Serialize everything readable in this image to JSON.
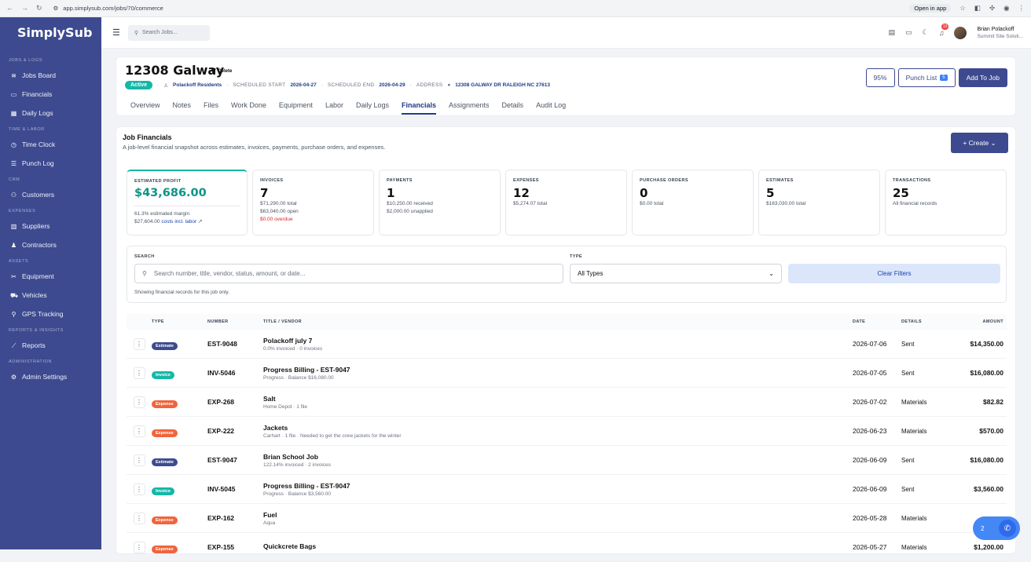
{
  "browser": {
    "url": "app.simplysub.com/jobs/70/commerce",
    "open_in_app": "Open in app"
  },
  "sidebar": {
    "logo": "SimplySub",
    "sections": [
      {
        "title": "JOBS & LOGS",
        "items": [
          {
            "label": "Jobs Board",
            "icon": "layers-icon"
          },
          {
            "label": "Financials",
            "icon": "cash-icon"
          },
          {
            "label": "Daily Logs",
            "icon": "calendar-icon"
          }
        ]
      },
      {
        "title": "TIME & LABOR",
        "items": [
          {
            "label": "Time Clock",
            "icon": "clock-icon"
          },
          {
            "label": "Punch Log",
            "icon": "list-icon"
          }
        ]
      },
      {
        "title": "CRM",
        "items": [
          {
            "label": "Customers",
            "icon": "users-icon"
          }
        ]
      },
      {
        "title": "EXPENSES",
        "items": [
          {
            "label": "Suppliers",
            "icon": "building-icon"
          },
          {
            "label": "Contractors",
            "icon": "person-icon"
          }
        ]
      },
      {
        "title": "ASSETS",
        "items": [
          {
            "label": "Equipment",
            "icon": "tools-icon"
          },
          {
            "label": "Vehicles",
            "icon": "car-icon"
          },
          {
            "label": "GPS Tracking",
            "icon": "pin-icon"
          }
        ]
      },
      {
        "title": "REPORTS & INSIGHTS",
        "items": [
          {
            "label": "Reports",
            "icon": "chart-icon"
          }
        ]
      },
      {
        "title": "ADMINISTRATION",
        "items": [
          {
            "label": "Admin Settings",
            "icon": "gear-icon"
          }
        ]
      }
    ]
  },
  "topbar": {
    "search_placeholder": "Search Jobs...",
    "notif_count": "13",
    "user_name": "Brian Polackoff",
    "user_company": "Summit Site Soluti..."
  },
  "job": {
    "title": "12308 Galway",
    "delete_label": "Delete",
    "status": "Active",
    "customer": "Polackoff Residents",
    "start_label": "SCHEDULED START",
    "start": "2026-04-27",
    "end_label": "SCHEDULED END",
    "end": "2026-04-29",
    "address_label": "ADDRESS",
    "address": "12308 GALWAY DR RALEIGH NC 27613",
    "progress": "95%",
    "punch_label": "Punch List",
    "punch_count": "5",
    "add_label": "Add To Job",
    "tabs": [
      "Overview",
      "Notes",
      "Files",
      "Work Done",
      "Equipment",
      "Labor",
      "Daily Logs",
      "Financials",
      "Assignments",
      "Details",
      "Audit Log"
    ],
    "active_tab": "Financials"
  },
  "financials": {
    "title": "Job Financials",
    "subtitle": "A job-level financial snapshot across estimates, invoices, payments, purchase orders, and expenses.",
    "create_label": "+ Create",
    "stats": [
      {
        "title": "ESTIMATED PROFIT",
        "value": "$43,686.00",
        "lines": [
          "61.3% estimated margin"
        ],
        "extra_prefix": "$27,604.00",
        "extra_link": "costs incl. labor"
      },
      {
        "title": "INVOICES",
        "value": "7",
        "lines": [
          "$71,290.00 total",
          "$63,040.00 open"
        ],
        "alert": "$0.00 overdue"
      },
      {
        "title": "PAYMENTS",
        "value": "1",
        "lines": [
          "$10,250.00 received",
          "$2,000.00 unapplied"
        ]
      },
      {
        "title": "EXPENSES",
        "value": "12",
        "lines": [
          "$5,274.07 total"
        ]
      },
      {
        "title": "PURCHASE ORDERS",
        "value": "0",
        "lines": [
          "$0.00 total"
        ]
      },
      {
        "title": "ESTIMATES",
        "value": "5",
        "lines": [
          "$163,030.00 total"
        ]
      },
      {
        "title": "TRANSACTIONS",
        "value": "25",
        "lines": [
          "All financial records"
        ]
      }
    ],
    "filters": {
      "search_label": "SEARCH",
      "search_placeholder": "Search number, title, vendor, status, amount, or date...",
      "type_label": "TYPE",
      "type_value": "All Types",
      "clear_label": "Clear Filters",
      "note": "Showing financial records for this job only."
    },
    "table": {
      "headers": {
        "type": "TYPE",
        "number": "NUMBER",
        "title": "TITLE / VENDOR",
        "date": "DATE",
        "details": "DETAILS",
        "amount": "AMOUNT"
      },
      "rows": [
        {
          "type": "Estimate",
          "number": "EST-9048",
          "title": "Polackoff july 7",
          "sub": "0.0% invoiced · 0 invoices",
          "date": "2026-07-06",
          "details": "Sent",
          "amount": "$14,350.00"
        },
        {
          "type": "Invoice",
          "number": "INV-5046",
          "title": "Progress Billing - EST-9047",
          "sub": "Progress · Balance $16,080.00",
          "date": "2026-07-05",
          "details": "Sent",
          "amount": "$16,080.00"
        },
        {
          "type": "Expense",
          "number": "EXP-268",
          "title": "Salt",
          "sub": "Home Depot · 1 file",
          "date": "2026-07-02",
          "details": "Materials",
          "amount": "$82.82"
        },
        {
          "type": "Expense",
          "number": "EXP-222",
          "title": "Jackets",
          "sub": "Carhart · 1 file · Needed to get the crew jackets for the winter",
          "date": "2026-06-23",
          "details": "Materials",
          "amount": "$570.00"
        },
        {
          "type": "Estimate",
          "number": "EST-9047",
          "title": "Brian School Job",
          "sub": "122.14% invoiced · 2 invoices",
          "date": "2026-06-09",
          "details": "Sent",
          "amount": "$16,080.00"
        },
        {
          "type": "Invoice",
          "number": "INV-5045",
          "title": "Progress Billing - EST-9047",
          "sub": "Progress · Balance $3,560.00",
          "date": "2026-06-09",
          "details": "Sent",
          "amount": "$3,560.00"
        },
        {
          "type": "Expense",
          "number": "EXP-162",
          "title": "Fuel",
          "sub": "Aqua",
          "date": "2026-05-28",
          "details": "Materials",
          "amount": ""
        },
        {
          "type": "Expense",
          "number": "EXP-155",
          "title": "Quickcrete Bags",
          "sub": "",
          "date": "2026-05-27",
          "details": "Materials",
          "amount": "$1,200.00"
        }
      ]
    },
    "badge_colors": {
      "Estimate": "#3d4a8f",
      "Invoice": "#14b8a6",
      "Expense": "#f0643c"
    }
  },
  "chat": {
    "count": "2"
  }
}
